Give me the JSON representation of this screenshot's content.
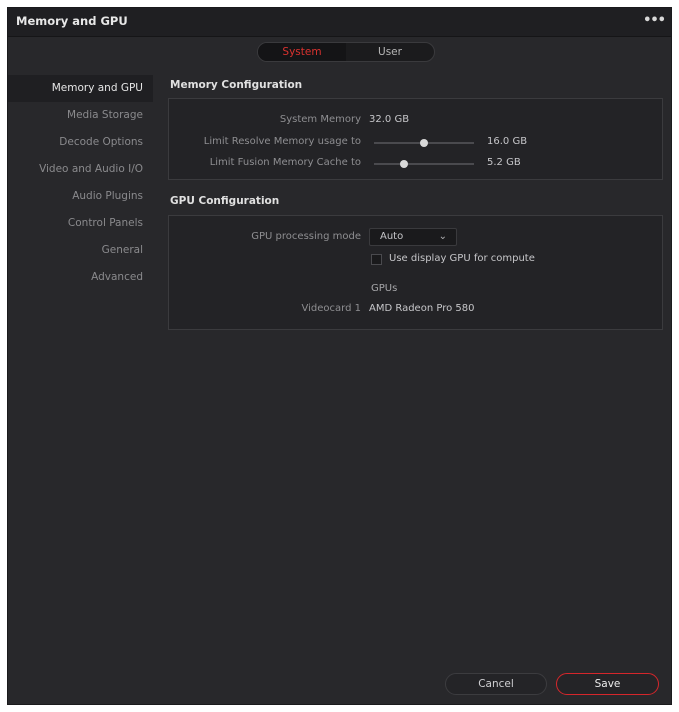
{
  "window": {
    "title": "Memory and GPU"
  },
  "tabs": {
    "system": "System",
    "user": "User"
  },
  "sidebar": {
    "items": [
      {
        "label": "Memory and GPU"
      },
      {
        "label": "Media Storage"
      },
      {
        "label": "Decode Options"
      },
      {
        "label": "Video and Audio I/O"
      },
      {
        "label": "Audio Plugins"
      },
      {
        "label": "Control Panels"
      },
      {
        "label": "General"
      },
      {
        "label": "Advanced"
      }
    ]
  },
  "memory": {
    "title": "Memory Configuration",
    "system_memory_label": "System Memory",
    "system_memory_value": "32.0 GB",
    "resolve_limit_label": "Limit Resolve Memory usage to",
    "resolve_limit_value": "16.0 GB",
    "resolve_limit_fraction": 0.5,
    "fusion_limit_label": "Limit Fusion Memory Cache to",
    "fusion_limit_value": "5.2 GB",
    "fusion_limit_fraction": 0.3
  },
  "gpu": {
    "title": "GPU Configuration",
    "mode_label": "GPU processing mode",
    "mode_value": "Auto",
    "display_gpu_label": "Use display GPU for compute",
    "display_gpu_checked": false,
    "gpus_header": "GPUs",
    "videocard_label": "Videocard 1",
    "videocard_value": "AMD Radeon Pro 580"
  },
  "footer": {
    "cancel_label": "Cancel",
    "save_label": "Save"
  },
  "colors": {
    "accent": "#d5262b",
    "background": "#28282b"
  }
}
